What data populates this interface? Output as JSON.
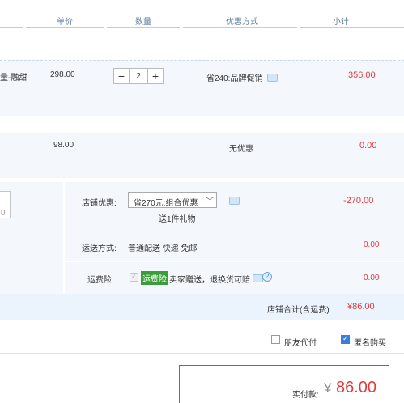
{
  "header": {
    "col_price": "单价",
    "col_qty": "数量",
    "col_discount": "优惠方式",
    "col_subtotal": "小计"
  },
  "items": [
    {
      "name_fragment": "量-融甜",
      "price": "298.00",
      "quantity": "2",
      "discount": "省240:品牌促销",
      "subtotal": "356.00"
    },
    {
      "price": "98.00",
      "discount": "无优惠",
      "subtotal": "0.00"
    }
  ],
  "left_field_fragment": "0",
  "shop": {
    "coupon_label": "店铺优惠:",
    "coupon_select": "省270元:组合优惠",
    "gift_note": "送1件礼物",
    "coupon_amount": "-270.00",
    "shipping_label": "运送方式:",
    "shipping_value": "普通配送 快递 免邮",
    "shipping_amount": "0.00",
    "insurance_label": "运费险:",
    "insurance_badge": "运费险",
    "insurance_text": "卖家赠送，退换货可赔",
    "insurance_amount": "0.00",
    "total_label": "店铺合计(含运费)",
    "total_value": "¥86.00"
  },
  "options": {
    "friend_pay": "朋友代付",
    "anonymous": "匿名购买"
  },
  "payment": {
    "label": "实付款:",
    "currency": "¥",
    "amount": "86.00"
  },
  "colors": {
    "accent_red": "#e4393c",
    "light_blue_bg": "#f4f8fd",
    "header_line": "#b8cfe6",
    "checkbox_blue": "#3a7fd5",
    "badge_green": "#3a9d3a"
  }
}
